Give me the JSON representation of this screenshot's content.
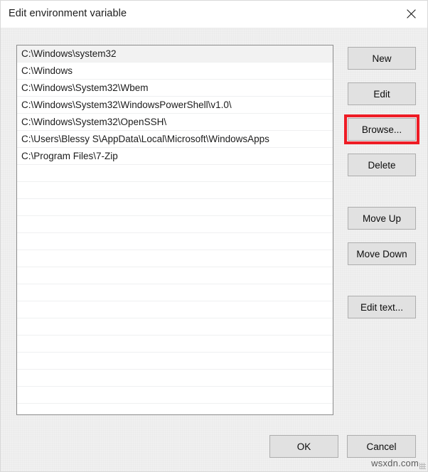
{
  "window": {
    "title": "Edit environment variable",
    "close_icon": "close-icon"
  },
  "list": {
    "selected_index": 0,
    "items": [
      "C:\\Windows\\system32",
      "C:\\Windows",
      "C:\\Windows\\System32\\Wbem",
      "C:\\Windows\\System32\\WindowsPowerShell\\v1.0\\",
      "C:\\Windows\\System32\\OpenSSH\\",
      "C:\\Users\\Blessy S\\AppData\\Local\\Microsoft\\WindowsApps",
      "C:\\Program Files\\7-Zip"
    ],
    "empty_row_count": 14
  },
  "side_buttons": {
    "new": "New",
    "edit": "Edit",
    "browse": "Browse...",
    "delete": "Delete",
    "move_up": "Move Up",
    "move_down": "Move Down",
    "edit_text": "Edit text..."
  },
  "footer_buttons": {
    "ok": "OK",
    "cancel": "Cancel"
  },
  "annotation": {
    "highlight_target": "browse",
    "highlight_color": "#ee1c25"
  },
  "watermark": {
    "text": "wsxdn.com"
  },
  "colors": {
    "dialog_background": "#f0f0f0",
    "titlebar_background": "#ffffff",
    "button_face": "#e1e1e1",
    "button_border": "#adadad",
    "listbox_border": "#8d8d8d",
    "list_row_separator": "#eff0f1",
    "selected_row": "#f2f2f2",
    "text": "#1c1c1c"
  }
}
